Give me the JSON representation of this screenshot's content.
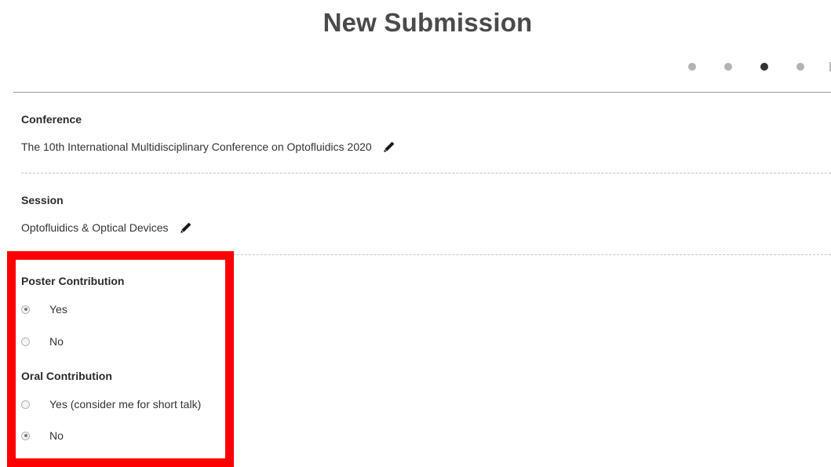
{
  "header": {
    "title": "New Submission"
  },
  "steps": {
    "total": 4,
    "current": 3
  },
  "conference": {
    "label": "Conference",
    "value": "The 10th International Multidisciplinary Conference on Optofluidics 2020",
    "edit_icon": "pencil-icon"
  },
  "session": {
    "label": "Session",
    "value": "Optofluidics & Optical Devices",
    "edit_icon": "pencil-icon"
  },
  "poster": {
    "label": "Poster Contribution",
    "options": [
      {
        "label": "Yes",
        "checked": true
      },
      {
        "label": "No",
        "checked": false
      }
    ]
  },
  "oral": {
    "label": "Oral Contribution",
    "options": [
      {
        "label": "Yes (consider me for short talk)",
        "checked": false
      },
      {
        "label": "No",
        "checked": true
      }
    ]
  },
  "colors": {
    "highlight": "#ff0000",
    "step_active": "#333333",
    "step_inactive": "#b3b3b3"
  }
}
